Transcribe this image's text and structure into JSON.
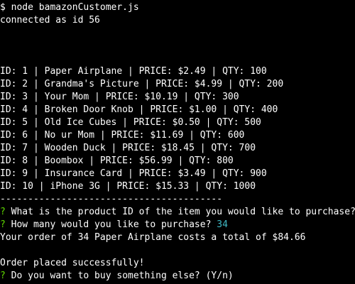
{
  "colors": {
    "background": "#000000",
    "text": "#ffffff",
    "prompt_mark": "#5fd700",
    "answer": "#3fb8c4"
  },
  "terminal": {
    "command": "$ node bamazonCustomer.js",
    "connection": "connected as id 56",
    "products": [
      "ID: 1 | Paper Airplane | PRICE: $2.49 | QTY: 100",
      "ID: 2 | Grandma's Picture | PRICE: $4.99 | QTY: 200",
      "ID: 3 | Your Mom | PRICE: $10.19 | QTY: 300",
      "ID: 4 | Broken Door Knob | PRICE: $1.00 | QTY: 400",
      "ID: 5 | Old Ice Cubes | PRICE: $0.50 | QTY: 500",
      "ID: 6 | No ur Mom | PRICE: $11.69 | QTY: 600",
      "ID: 7 | Wooden Duck | PRICE: $18.45 | QTY: 700",
      "ID: 8 | Boombox | PRICE: $56.99 | QTY: 800",
      "ID: 9 | Insurance Card | PRICE: $3.49 | QTY: 900",
      "ID: 10 | iPhone 3G | PRICE: $15.33 | QTY: 1000"
    ],
    "separator": "----------------------------------------",
    "question_mark": "?",
    "q1": " What is the product ID of the item you would like to purchase?",
    "q2": " How many would you like to purchase? ",
    "q2_answer": "34",
    "order_summary": "Your order of 34 Paper Airplane costs a total of $84.66",
    "success": "Order placed successfully!",
    "q3": " Do you want to buy something else? (Y/n)"
  }
}
